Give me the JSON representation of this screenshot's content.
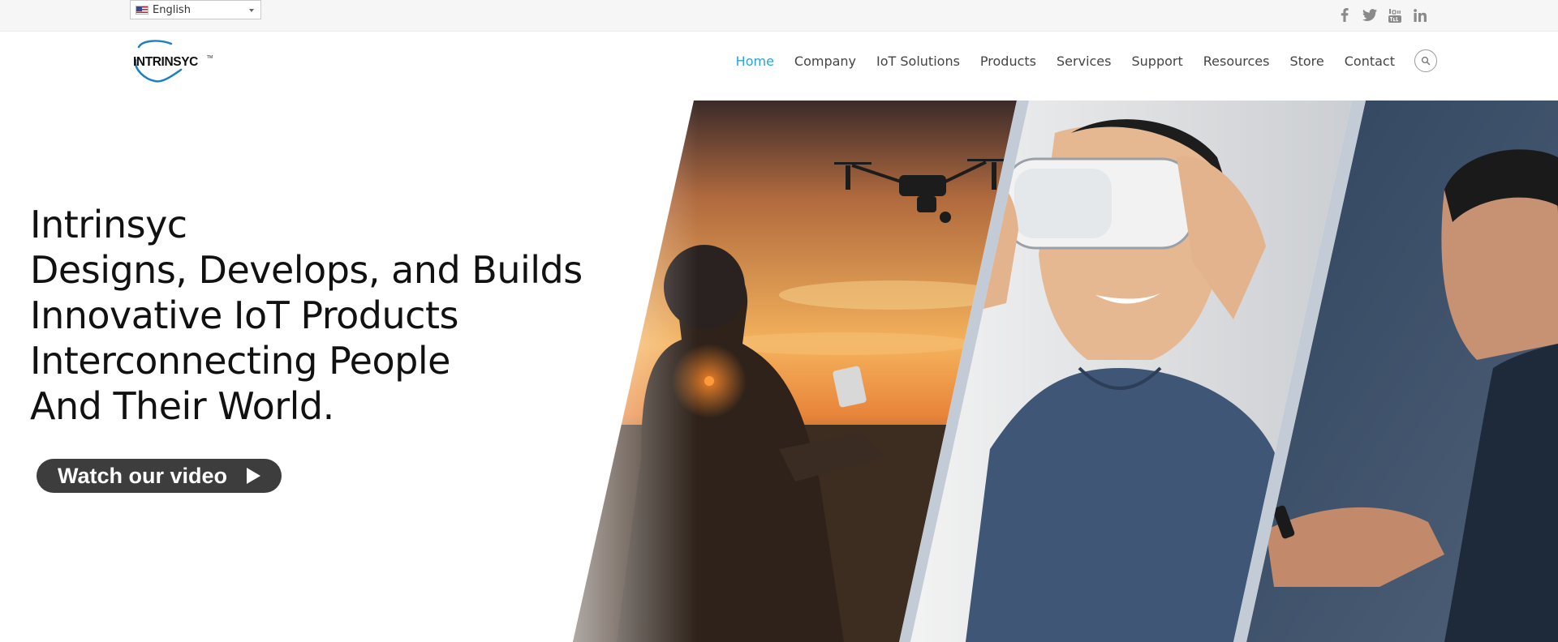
{
  "language_selector": {
    "label": "English"
  },
  "social": [
    "facebook-icon",
    "twitter-icon",
    "youtube-icon",
    "linkedin-icon"
  ],
  "logo": {
    "text": "INTRINSYC"
  },
  "nav": {
    "items": [
      "Home",
      "Company",
      "IoT Solutions",
      "Products",
      "Services",
      "Support",
      "Resources",
      "Store",
      "Contact"
    ],
    "active": "Home"
  },
  "hero": {
    "headline": [
      "Intrinsyc",
      "Designs, Develops, and Builds",
      "Innovative IoT Products",
      "Interconnecting People",
      "And Their World."
    ],
    "video_button": "Watch our video"
  },
  "colors": {
    "accent": "#2aa3d9",
    "button": "#3d3d3d",
    "text": "#111111"
  }
}
